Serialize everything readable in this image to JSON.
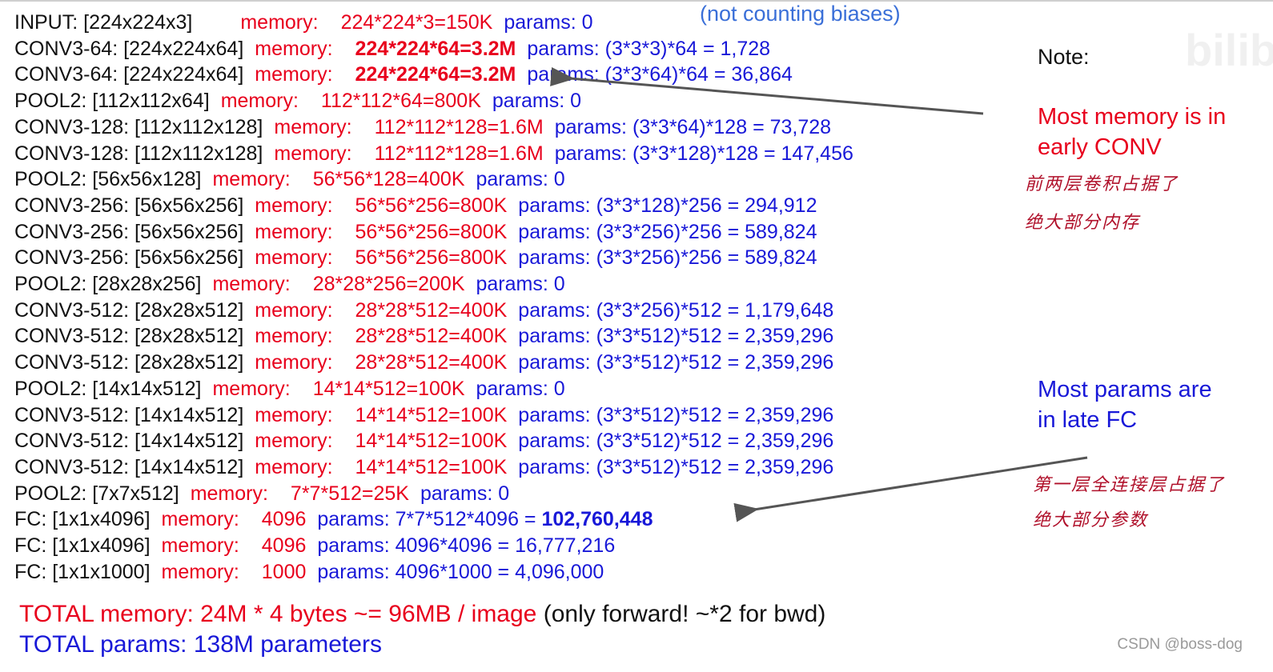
{
  "header_note": "(not counting biases)",
  "rows": [
    {
      "layer": "INPUT: [224x224x3]",
      "mem_label": "memory:",
      "mem": "224*224*3=150K",
      "mem_bold": false,
      "params_label": "params:",
      "params": "0",
      "params_bold": ""
    },
    {
      "layer": "CONV3-64: [224x224x64]",
      "mem_label": "memory:",
      "mem": "224*224*64=3.2M",
      "mem_bold": true,
      "params_label": "params:",
      "params": "(3*3*3)*64 = 1,728",
      "params_bold": ""
    },
    {
      "layer": "CONV3-64: [224x224x64]",
      "mem_label": "memory:",
      "mem": "224*224*64=3.2M",
      "mem_bold": true,
      "params_label": "params:",
      "params": "(3*3*64)*64 = 36,864",
      "params_bold": ""
    },
    {
      "layer": "POOL2: [112x112x64]",
      "mem_label": "memory:",
      "mem": "112*112*64=800K",
      "mem_bold": false,
      "params_label": "params:",
      "params": "0",
      "params_bold": ""
    },
    {
      "layer": "CONV3-128: [112x112x128]",
      "mem_label": "memory:",
      "mem": "112*112*128=1.6M",
      "mem_bold": false,
      "params_label": "params:",
      "params": "(3*3*64)*128 = 73,728",
      "params_bold": ""
    },
    {
      "layer": "CONV3-128: [112x112x128]",
      "mem_label": "memory:",
      "mem": "112*112*128=1.6M",
      "mem_bold": false,
      "params_label": "params:",
      "params": "(3*3*128)*128 = 147,456",
      "params_bold": ""
    },
    {
      "layer": "POOL2: [56x56x128]",
      "mem_label": "memory:",
      "mem": "56*56*128=400K",
      "mem_bold": false,
      "params_label": "params:",
      "params": "0",
      "params_bold": ""
    },
    {
      "layer": "CONV3-256: [56x56x256]",
      "mem_label": "memory:",
      "mem": "56*56*256=800K",
      "mem_bold": false,
      "params_label": "params:",
      "params": "(3*3*128)*256 = 294,912",
      "params_bold": ""
    },
    {
      "layer": "CONV3-256: [56x56x256]",
      "mem_label": "memory:",
      "mem": "56*56*256=800K",
      "mem_bold": false,
      "params_label": "params:",
      "params": "(3*3*256)*256 = 589,824",
      "params_bold": ""
    },
    {
      "layer": "CONV3-256: [56x56x256]",
      "mem_label": "memory:",
      "mem": "56*56*256=800K",
      "mem_bold": false,
      "params_label": "params:",
      "params": "(3*3*256)*256 = 589,824",
      "params_bold": ""
    },
    {
      "layer": "POOL2: [28x28x256]",
      "mem_label": "memory:",
      "mem": "28*28*256=200K",
      "mem_bold": false,
      "params_label": "params:",
      "params": "0",
      "params_bold": ""
    },
    {
      "layer": "CONV3-512: [28x28x512]",
      "mem_label": "memory:",
      "mem": "28*28*512=400K",
      "mem_bold": false,
      "params_label": "params:",
      "params": "(3*3*256)*512 = 1,179,648",
      "params_bold": ""
    },
    {
      "layer": "CONV3-512: [28x28x512]",
      "mem_label": "memory:",
      "mem": "28*28*512=400K",
      "mem_bold": false,
      "params_label": "params:",
      "params": "(3*3*512)*512 = 2,359,296",
      "params_bold": ""
    },
    {
      "layer": "CONV3-512: [28x28x512]",
      "mem_label": "memory:",
      "mem": "28*28*512=400K",
      "mem_bold": false,
      "params_label": "params:",
      "params": "(3*3*512)*512 = 2,359,296",
      "params_bold": ""
    },
    {
      "layer": "POOL2: [14x14x512]",
      "mem_label": "memory:",
      "mem": "14*14*512=100K",
      "mem_bold": false,
      "params_label": "params:",
      "params": "0",
      "params_bold": ""
    },
    {
      "layer": "CONV3-512: [14x14x512]",
      "mem_label": "memory:",
      "mem": "14*14*512=100K",
      "mem_bold": false,
      "params_label": "params:",
      "params": "(3*3*512)*512 = 2,359,296",
      "params_bold": ""
    },
    {
      "layer": "CONV3-512: [14x14x512]",
      "mem_label": "memory:",
      "mem": "14*14*512=100K",
      "mem_bold": false,
      "params_label": "params:",
      "params": "(3*3*512)*512 = 2,359,296",
      "params_bold": ""
    },
    {
      "layer": "CONV3-512: [14x14x512]",
      "mem_label": "memory:",
      "mem": "14*14*512=100K",
      "mem_bold": false,
      "params_label": "params:",
      "params": "(3*3*512)*512 = 2,359,296",
      "params_bold": ""
    },
    {
      "layer": "POOL2: [7x7x512]",
      "mem_label": "memory:",
      "mem": "7*7*512=25K",
      "mem_bold": false,
      "params_label": "params:",
      "params": "0",
      "params_bold": ""
    },
    {
      "layer": "FC: [1x1x4096]",
      "mem_label": "memory:",
      "mem": "4096",
      "mem_bold": false,
      "params_label": "params:",
      "params": "7*7*512*4096 = ",
      "params_bold": "102,760,448"
    },
    {
      "layer": "FC: [1x1x4096]",
      "mem_label": "memory:",
      "mem": "4096",
      "mem_bold": false,
      "params_label": "params:",
      "params": "4096*4096 = 16,777,216",
      "params_bold": ""
    },
    {
      "layer": "FC: [1x1x1000]",
      "mem_label": "memory:",
      "mem": "1000",
      "mem_bold": false,
      "params_label": "params:",
      "params": "4096*1000 = 4,096,000",
      "params_bold": ""
    }
  ],
  "notes": {
    "note_label": "Note:",
    "memory_note": [
      "Most memory is in",
      "early CONV"
    ],
    "memory_hand": [
      "前两层卷积占据了",
      "绝大部分内存"
    ],
    "params_note": [
      "Most params are",
      "in late FC"
    ],
    "params_hand": [
      "第一层全连接层占据了",
      "绝大部分参数"
    ]
  },
  "totals": {
    "memory": "TOTAL memory: 24M * 4 bytes ~= 96MB / image",
    "memory_suffix": " (only forward! ~*2 for bwd)",
    "params": "TOTAL params: 138M parameters"
  },
  "watermark": "CSDN @boss-dog",
  "watermark_logo": "bilibili",
  "colors": {
    "memory": "#e8001c",
    "params": "#1818d8",
    "layer": "#111111",
    "handwriting": "#b0102a",
    "arrow": "#555555"
  }
}
